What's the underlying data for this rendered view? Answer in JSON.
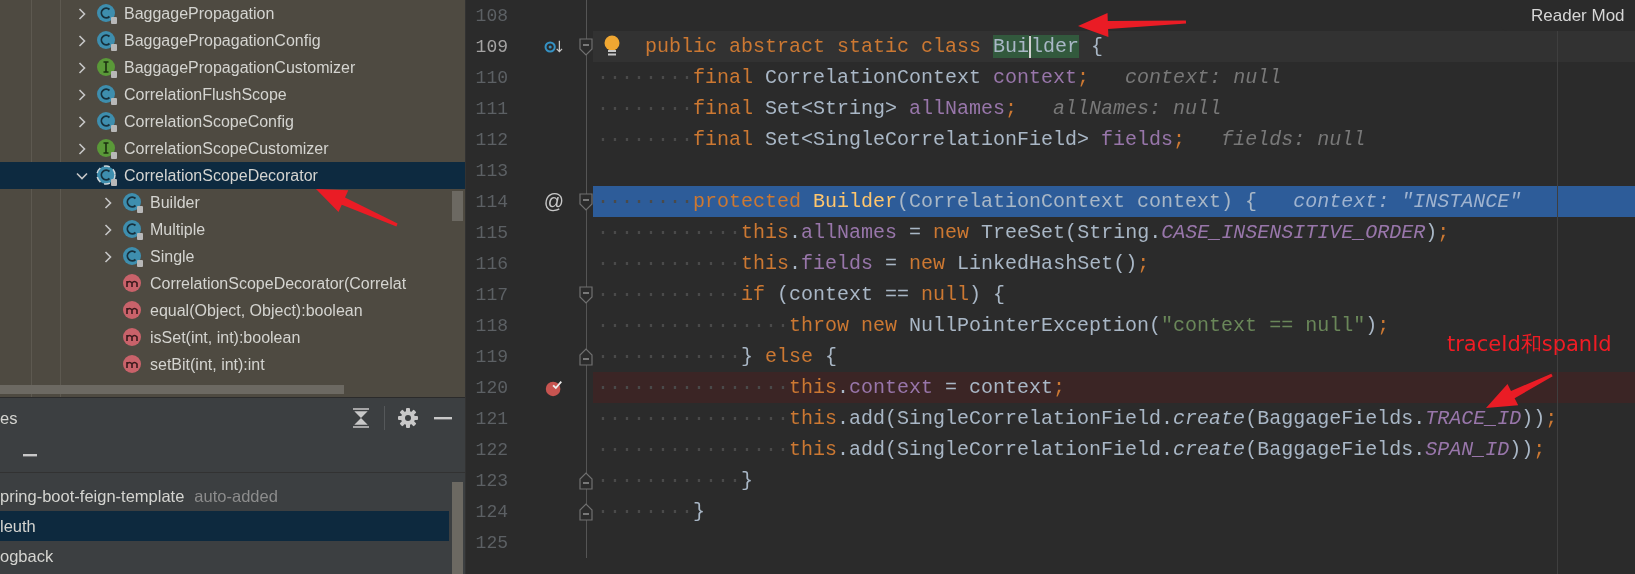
{
  "project_tree": {
    "items": [
      {
        "label": "BaggagePropagation",
        "kind": "class",
        "expanded": false,
        "selected": false
      },
      {
        "label": "BaggagePropagationConfig",
        "kind": "class",
        "expanded": false,
        "selected": false
      },
      {
        "label": "BaggagePropagationCustomizer",
        "kind": "interface",
        "expanded": false,
        "selected": false
      },
      {
        "label": "CorrelationFlushScope",
        "kind": "class",
        "expanded": false,
        "selected": false
      },
      {
        "label": "CorrelationScopeConfig",
        "kind": "class",
        "expanded": false,
        "selected": false
      },
      {
        "label": "CorrelationScopeCustomizer",
        "kind": "interface",
        "expanded": false,
        "selected": false
      },
      {
        "label": "CorrelationScopeDecorator",
        "kind": "abstract-class",
        "expanded": true,
        "selected": true,
        "children": [
          {
            "label": "Builder",
            "kind": "class",
            "expanded": false,
            "selected": false
          },
          {
            "label": "Multiple",
            "kind": "class",
            "expanded": false,
            "selected": false
          },
          {
            "label": "Single",
            "kind": "class",
            "expanded": false,
            "selected": false
          },
          {
            "label": "CorrelationScopeDecorator(Correlat",
            "kind": "method",
            "selected": false
          },
          {
            "label": "equal(Object, Object):boolean",
            "kind": "method",
            "selected": false
          },
          {
            "label": "isSet(int, int):boolean",
            "kind": "method",
            "selected": false
          },
          {
            "label": "setBit(int, int):int",
            "kind": "method",
            "selected": false
          }
        ]
      }
    ]
  },
  "libraries_panel": {
    "title": "es",
    "items": [
      {
        "label": "pring-boot-feign-template",
        "note": "auto-added",
        "selected": false
      },
      {
        "label": "leuth",
        "selected": true
      },
      {
        "label": "ogback",
        "selected": false
      }
    ]
  },
  "editor": {
    "reader_mode": "Reader Mod",
    "lines": [
      {
        "number": "108"
      },
      {
        "number": "109",
        "current": true,
        "implements_marker": true,
        "fold_start": true,
        "intention_bulb": true,
        "tokens": [
          {
            "kind": "kw",
            "text": "public abstract static class "
          },
          {
            "kind": "match",
            "text": "Bui"
          },
          {
            "kind": "caret"
          },
          {
            "kind": "match",
            "text": "lder"
          },
          {
            "kind": "plain",
            "text": " {"
          }
        ]
      },
      {
        "number": "110",
        "tokens": [
          {
            "kind": "ws",
            "text": "········"
          },
          {
            "kind": "kw",
            "text": "final "
          },
          {
            "kind": "plain",
            "text": "CorrelationContext "
          },
          {
            "kind": "field",
            "text": "context"
          },
          {
            "kind": "kw",
            "text": ";"
          },
          {
            "kind": "hint",
            "text": "   context: null"
          }
        ]
      },
      {
        "number": "111",
        "tokens": [
          {
            "kind": "ws",
            "text": "········"
          },
          {
            "kind": "kw",
            "text": "final "
          },
          {
            "kind": "plain",
            "text": "Set<String> "
          },
          {
            "kind": "field",
            "text": "allNames"
          },
          {
            "kind": "kw",
            "text": ";"
          },
          {
            "kind": "hint",
            "text": "   allNames: null"
          }
        ]
      },
      {
        "number": "112",
        "tokens": [
          {
            "kind": "ws",
            "text": "········"
          },
          {
            "kind": "kw",
            "text": "final "
          },
          {
            "kind": "plain",
            "text": "Set<SingleCorrelationField> "
          },
          {
            "kind": "field",
            "text": "fields"
          },
          {
            "kind": "kw",
            "text": ";"
          },
          {
            "kind": "hint",
            "text": "   fields: null"
          }
        ]
      },
      {
        "number": "113"
      },
      {
        "number": "114",
        "gutter_mark": "@",
        "fold_start": true,
        "execution_point": true,
        "tokens": [
          {
            "kind": "ws",
            "text": "········"
          },
          {
            "kind": "kw",
            "text": "protected "
          },
          {
            "kind": "decl",
            "text": "Builder"
          },
          {
            "kind": "plain",
            "text": "(CorrelationContext context) {"
          },
          {
            "kind": "hint",
            "text": "   context: \"INSTANCE\""
          }
        ]
      },
      {
        "number": "115",
        "tokens": [
          {
            "kind": "ws",
            "text": "············"
          },
          {
            "kind": "kw",
            "text": "this"
          },
          {
            "kind": "plain",
            "text": "."
          },
          {
            "kind": "field",
            "text": "allNames"
          },
          {
            "kind": "plain",
            "text": " = "
          },
          {
            "kind": "kw",
            "text": "new "
          },
          {
            "kind": "plain",
            "text": "TreeSet(String."
          },
          {
            "kind": "const",
            "text": "CASE_INSENSITIVE_ORDER"
          },
          {
            "kind": "plain",
            "text": ")"
          },
          {
            "kind": "kw",
            "text": ";"
          }
        ]
      },
      {
        "number": "116",
        "tokens": [
          {
            "kind": "ws",
            "text": "············"
          },
          {
            "kind": "kw",
            "text": "this"
          },
          {
            "kind": "plain",
            "text": "."
          },
          {
            "kind": "field",
            "text": "fields"
          },
          {
            "kind": "plain",
            "text": " = "
          },
          {
            "kind": "kw",
            "text": "new "
          },
          {
            "kind": "plain",
            "text": "LinkedHashSet()"
          },
          {
            "kind": "kw",
            "text": ";"
          }
        ]
      },
      {
        "number": "117",
        "fold_start": true,
        "tokens": [
          {
            "kind": "ws",
            "text": "············"
          },
          {
            "kind": "kw",
            "text": "if "
          },
          {
            "kind": "plain",
            "text": "(context == "
          },
          {
            "kind": "kw",
            "text": "null"
          },
          {
            "kind": "plain",
            "text": ") {"
          }
        ]
      },
      {
        "number": "118",
        "tokens": [
          {
            "kind": "ws",
            "text": "················"
          },
          {
            "kind": "kw",
            "text": "throw new "
          },
          {
            "kind": "plain",
            "text": "NullPointerException("
          },
          {
            "kind": "str",
            "text": "\"context == null\""
          },
          {
            "kind": "plain",
            "text": ")"
          },
          {
            "kind": "kw",
            "text": ";"
          }
        ]
      },
      {
        "number": "119",
        "fold_end": true,
        "tokens": [
          {
            "kind": "ws",
            "text": "············"
          },
          {
            "kind": "plain",
            "text": "} "
          },
          {
            "kind": "kw",
            "text": "else "
          },
          {
            "kind": "plain",
            "text": "{"
          }
        ]
      },
      {
        "number": "120",
        "breakpoint": true,
        "tokens": [
          {
            "kind": "ws",
            "text": "················"
          },
          {
            "kind": "kw",
            "text": "this"
          },
          {
            "kind": "plain",
            "text": "."
          },
          {
            "kind": "field",
            "text": "context"
          },
          {
            "kind": "plain",
            "text": " = context"
          },
          {
            "kind": "kw",
            "text": ";"
          }
        ]
      },
      {
        "number": "121",
        "tokens": [
          {
            "kind": "ws",
            "text": "················"
          },
          {
            "kind": "kw",
            "text": "this"
          },
          {
            "kind": "plain",
            "text": ".add(SingleCorrelationField."
          },
          {
            "kind": "italic",
            "text": "create"
          },
          {
            "kind": "plain",
            "text": "(BaggageFields."
          },
          {
            "kind": "const",
            "text": "TRACE_ID"
          },
          {
            "kind": "plain",
            "text": "))"
          },
          {
            "kind": "kw",
            "text": ";"
          }
        ]
      },
      {
        "number": "122",
        "tokens": [
          {
            "kind": "ws",
            "text": "················"
          },
          {
            "kind": "kw",
            "text": "this"
          },
          {
            "kind": "plain",
            "text": ".add(SingleCorrelationField."
          },
          {
            "kind": "italic",
            "text": "create"
          },
          {
            "kind": "plain",
            "text": "(BaggageFields."
          },
          {
            "kind": "const",
            "text": "SPAN_ID"
          },
          {
            "kind": "plain",
            "text": "))"
          },
          {
            "kind": "kw",
            "text": ";"
          }
        ]
      },
      {
        "number": "123",
        "fold_end": true,
        "tokens": [
          {
            "kind": "ws",
            "text": "············"
          },
          {
            "kind": "plain",
            "text": "}"
          }
        ]
      },
      {
        "number": "124",
        "fold_end": true,
        "tokens": [
          {
            "kind": "ws",
            "text": "········"
          },
          {
            "kind": "plain",
            "text": "}"
          }
        ]
      },
      {
        "number": "125"
      }
    ]
  },
  "annotation_text": "traceId和spanId"
}
